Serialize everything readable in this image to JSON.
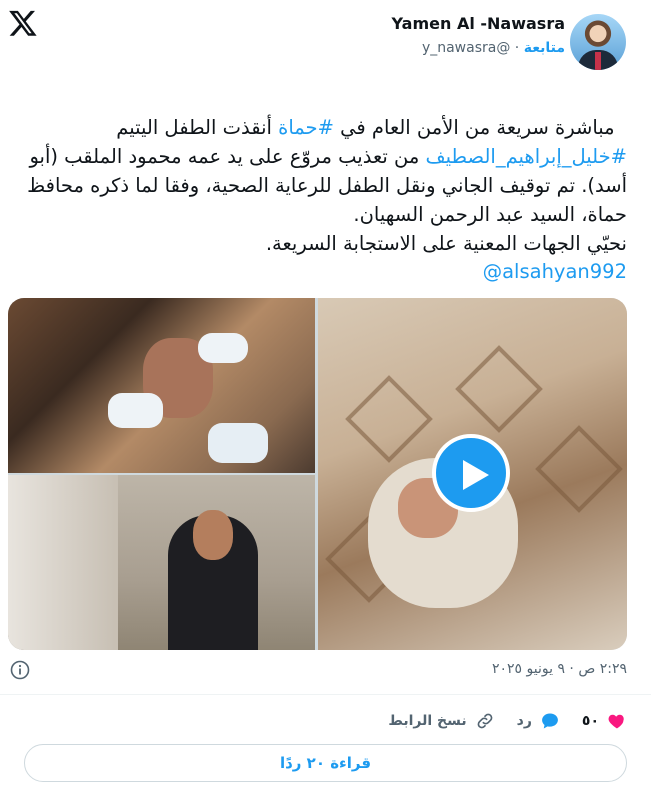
{
  "header": {
    "display_name": "Yamen Al -Nawasra",
    "handle": "@y_nawasra",
    "separator": "·",
    "follow_label": "متابعة"
  },
  "tweet": {
    "segments": [
      {
        "text": "مباشرة سريعة من الأمن العام في ",
        "link": false
      },
      {
        "text": "#حماة",
        "link": true
      },
      {
        "text": " أنقذت الطفل اليتيم ",
        "link": false
      },
      {
        "text": "#خليل_إبراهيم_الصطيف",
        "link": true
      },
      {
        "text": " من تعذيب مروّع على يد عمه محمود الملقب (أبو أسد). تم توقيف الجاني ونقل الطفل للرعاية الصحية، وفقا لما ذكره محافظ حماة، السيد عبد الرحمن السهيان.\nنحيّي الجهات المعنية على الاستجابة السريعة.",
        "link": false
      }
    ],
    "mention": "@alsahyan992"
  },
  "media": {
    "play_icon": "play-icon"
  },
  "meta": {
    "timestamp": "٢:٢٩ ص · ٩ يونيو ٢٠٢٥"
  },
  "actions": {
    "like_count": "٥٠",
    "reply_label": "رد",
    "copy_link_label": "نسخ الرابط"
  },
  "read_replies_label": "قراءة ٢٠ ردًا",
  "colors": {
    "accent": "#1d9bf0",
    "like": "#f91880",
    "text": "#0f1419",
    "muted": "#536471"
  }
}
